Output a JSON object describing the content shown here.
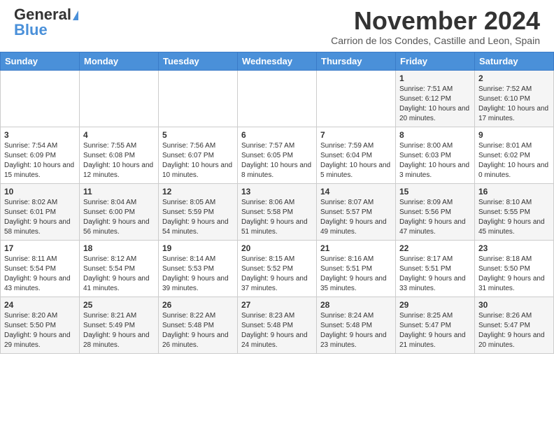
{
  "header": {
    "logo_line1": "General",
    "logo_line2": "Blue",
    "month_year": "November 2024",
    "location": "Carrion de los Condes, Castille and Leon, Spain"
  },
  "weekdays": [
    "Sunday",
    "Monday",
    "Tuesday",
    "Wednesday",
    "Thursday",
    "Friday",
    "Saturday"
  ],
  "weeks": [
    [
      {
        "day": "",
        "info": ""
      },
      {
        "day": "",
        "info": ""
      },
      {
        "day": "",
        "info": ""
      },
      {
        "day": "",
        "info": ""
      },
      {
        "day": "",
        "info": ""
      },
      {
        "day": "1",
        "info": "Sunrise: 7:51 AM\nSunset: 6:12 PM\nDaylight: 10 hours and 20 minutes."
      },
      {
        "day": "2",
        "info": "Sunrise: 7:52 AM\nSunset: 6:10 PM\nDaylight: 10 hours and 17 minutes."
      }
    ],
    [
      {
        "day": "3",
        "info": "Sunrise: 7:54 AM\nSunset: 6:09 PM\nDaylight: 10 hours and 15 minutes."
      },
      {
        "day": "4",
        "info": "Sunrise: 7:55 AM\nSunset: 6:08 PM\nDaylight: 10 hours and 12 minutes."
      },
      {
        "day": "5",
        "info": "Sunrise: 7:56 AM\nSunset: 6:07 PM\nDaylight: 10 hours and 10 minutes."
      },
      {
        "day": "6",
        "info": "Sunrise: 7:57 AM\nSunset: 6:05 PM\nDaylight: 10 hours and 8 minutes."
      },
      {
        "day": "7",
        "info": "Sunrise: 7:59 AM\nSunset: 6:04 PM\nDaylight: 10 hours and 5 minutes."
      },
      {
        "day": "8",
        "info": "Sunrise: 8:00 AM\nSunset: 6:03 PM\nDaylight: 10 hours and 3 minutes."
      },
      {
        "day": "9",
        "info": "Sunrise: 8:01 AM\nSunset: 6:02 PM\nDaylight: 10 hours and 0 minutes."
      }
    ],
    [
      {
        "day": "10",
        "info": "Sunrise: 8:02 AM\nSunset: 6:01 PM\nDaylight: 9 hours and 58 minutes."
      },
      {
        "day": "11",
        "info": "Sunrise: 8:04 AM\nSunset: 6:00 PM\nDaylight: 9 hours and 56 minutes."
      },
      {
        "day": "12",
        "info": "Sunrise: 8:05 AM\nSunset: 5:59 PM\nDaylight: 9 hours and 54 minutes."
      },
      {
        "day": "13",
        "info": "Sunrise: 8:06 AM\nSunset: 5:58 PM\nDaylight: 9 hours and 51 minutes."
      },
      {
        "day": "14",
        "info": "Sunrise: 8:07 AM\nSunset: 5:57 PM\nDaylight: 9 hours and 49 minutes."
      },
      {
        "day": "15",
        "info": "Sunrise: 8:09 AM\nSunset: 5:56 PM\nDaylight: 9 hours and 47 minutes."
      },
      {
        "day": "16",
        "info": "Sunrise: 8:10 AM\nSunset: 5:55 PM\nDaylight: 9 hours and 45 minutes."
      }
    ],
    [
      {
        "day": "17",
        "info": "Sunrise: 8:11 AM\nSunset: 5:54 PM\nDaylight: 9 hours and 43 minutes."
      },
      {
        "day": "18",
        "info": "Sunrise: 8:12 AM\nSunset: 5:54 PM\nDaylight: 9 hours and 41 minutes."
      },
      {
        "day": "19",
        "info": "Sunrise: 8:14 AM\nSunset: 5:53 PM\nDaylight: 9 hours and 39 minutes."
      },
      {
        "day": "20",
        "info": "Sunrise: 8:15 AM\nSunset: 5:52 PM\nDaylight: 9 hours and 37 minutes."
      },
      {
        "day": "21",
        "info": "Sunrise: 8:16 AM\nSunset: 5:51 PM\nDaylight: 9 hours and 35 minutes."
      },
      {
        "day": "22",
        "info": "Sunrise: 8:17 AM\nSunset: 5:51 PM\nDaylight: 9 hours and 33 minutes."
      },
      {
        "day": "23",
        "info": "Sunrise: 8:18 AM\nSunset: 5:50 PM\nDaylight: 9 hours and 31 minutes."
      }
    ],
    [
      {
        "day": "24",
        "info": "Sunrise: 8:20 AM\nSunset: 5:50 PM\nDaylight: 9 hours and 29 minutes."
      },
      {
        "day": "25",
        "info": "Sunrise: 8:21 AM\nSunset: 5:49 PM\nDaylight: 9 hours and 28 minutes."
      },
      {
        "day": "26",
        "info": "Sunrise: 8:22 AM\nSunset: 5:48 PM\nDaylight: 9 hours and 26 minutes."
      },
      {
        "day": "27",
        "info": "Sunrise: 8:23 AM\nSunset: 5:48 PM\nDaylight: 9 hours and 24 minutes."
      },
      {
        "day": "28",
        "info": "Sunrise: 8:24 AM\nSunset: 5:48 PM\nDaylight: 9 hours and 23 minutes."
      },
      {
        "day": "29",
        "info": "Sunrise: 8:25 AM\nSunset: 5:47 PM\nDaylight: 9 hours and 21 minutes."
      },
      {
        "day": "30",
        "info": "Sunrise: 8:26 AM\nSunset: 5:47 PM\nDaylight: 9 hours and 20 minutes."
      }
    ]
  ]
}
